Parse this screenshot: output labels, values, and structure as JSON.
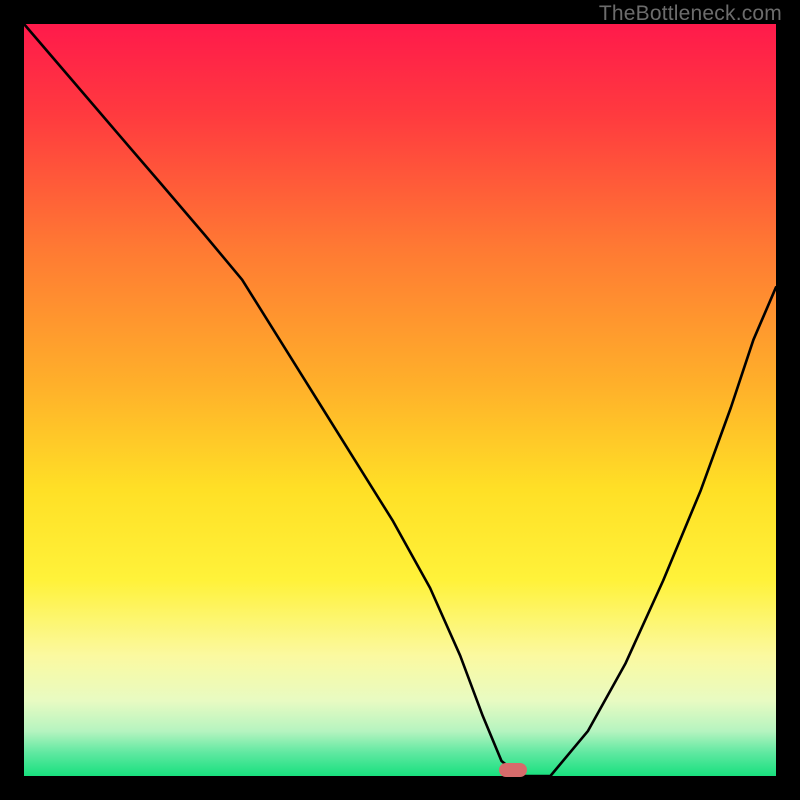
{
  "watermark": "TheBottleneck.com",
  "chart_data": {
    "type": "line",
    "title": "",
    "xlabel": "",
    "ylabel": "",
    "xlim": [
      0,
      100
    ],
    "ylim": [
      0,
      100
    ],
    "bg_gradient": [
      {
        "stop": 0,
        "color": "#ff1a4b"
      },
      {
        "stop": 12,
        "color": "#ff3a3f"
      },
      {
        "stop": 30,
        "color": "#ff7a33"
      },
      {
        "stop": 48,
        "color": "#ffb02a"
      },
      {
        "stop": 62,
        "color": "#ffe026"
      },
      {
        "stop": 74,
        "color": "#fff23a"
      },
      {
        "stop": 84,
        "color": "#fbf9a0"
      },
      {
        "stop": 90,
        "color": "#e8fbc2"
      },
      {
        "stop": 94,
        "color": "#b6f4c0"
      },
      {
        "stop": 97,
        "color": "#5de8a0"
      },
      {
        "stop": 100,
        "color": "#18e07e"
      }
    ],
    "series": [
      {
        "name": "bottleneck-curve",
        "x": [
          0,
          6,
          12,
          18,
          24,
          29,
          34,
          39,
          44,
          49,
          54,
          58,
          61,
          63.5,
          66,
          70,
          75,
          80,
          85,
          90,
          94,
          97,
          100
        ],
        "y": [
          100,
          93,
          86,
          79,
          72,
          66,
          58,
          50,
          42,
          34,
          25,
          16,
          8,
          2,
          0,
          0,
          6,
          15,
          26,
          38,
          49,
          58,
          65
        ]
      }
    ],
    "optimum_marker": {
      "x": 65,
      "y": 0.8,
      "color": "#d66b6b"
    },
    "curve_stroke": "#000000",
    "curve_width": 2.6
  }
}
